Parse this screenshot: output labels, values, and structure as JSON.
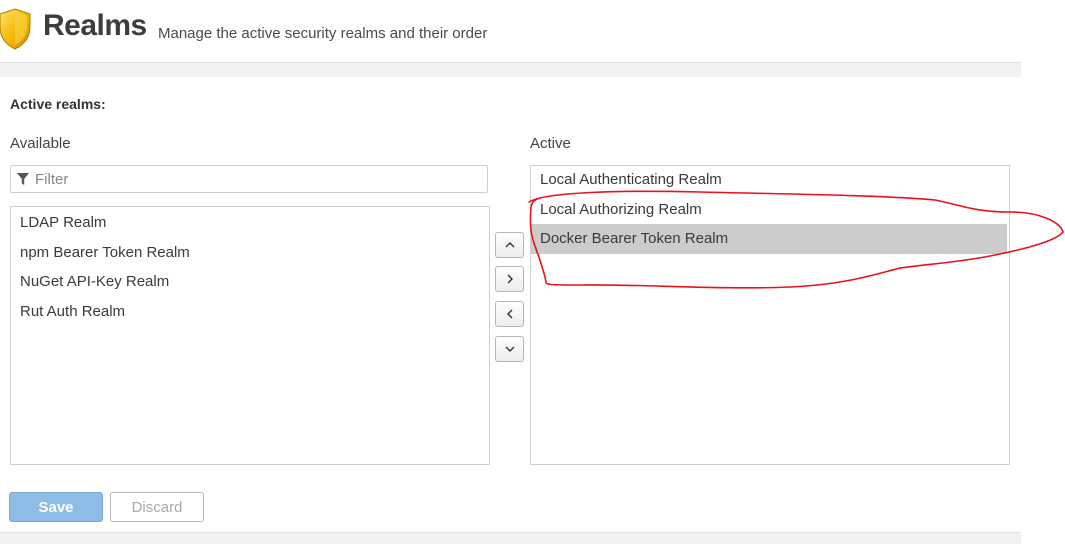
{
  "header": {
    "title": "Realms",
    "subtitle": "Manage the active security realms and their order",
    "icon": "shield-icon"
  },
  "form": {
    "section_label": "Active realms:",
    "available": {
      "label": "Available",
      "filter_placeholder": "Filter",
      "filter_value": "",
      "items": [
        "LDAP Realm",
        "npm Bearer Token Realm",
        "NuGet API-Key Realm",
        "Rut Auth Realm"
      ]
    },
    "active": {
      "label": "Active",
      "items": [
        "Local Authenticating Realm",
        "Local Authorizing Realm",
        "Docker Bearer Token Realm"
      ],
      "selected_index": 2
    },
    "move_buttons": [
      "chevron-up-icon",
      "chevron-right-icon",
      "chevron-left-icon",
      "chevron-down-icon"
    ]
  },
  "actions": {
    "save_label": "Save",
    "discard_label": "Discard"
  },
  "colors": {
    "save_bg": "#8dbde6",
    "selected_item_bg": "#cccccc",
    "annotation_stroke": "#e8121a",
    "shield_gold": "#f2b705"
  }
}
